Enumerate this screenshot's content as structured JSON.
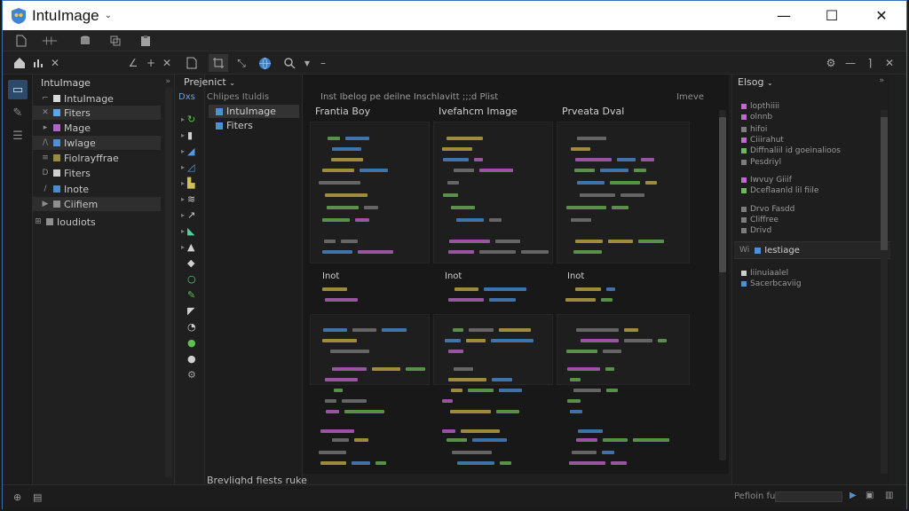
{
  "window": {
    "title": "IntuImage",
    "controls": {
      "minimize": "—",
      "maximize": "☐",
      "close": "✕"
    }
  },
  "explorer": {
    "title": "IntuImage",
    "items": [
      {
        "label": "IntuImage",
        "color": "#d8d8d8",
        "glyph": "⌐"
      },
      {
        "label": "Fiters",
        "color": "#5aa6e8",
        "glyph": "✕"
      },
      {
        "label": "Mage",
        "color": "#b265c8",
        "glyph": "▸"
      },
      {
        "label": "Iwlage",
        "color": "#4f8fd6",
        "glyph": "/\\"
      },
      {
        "label": "Fiolrayffrae",
        "color": "#9c8a3c",
        "glyph": "≡"
      },
      {
        "label": "Fiters",
        "color": "#cfcfcf",
        "glyph": "D"
      },
      {
        "label": "Inote",
        "color": "#4a8bd0",
        "glyph": "/"
      },
      {
        "label": "Ciifiem",
        "color": "#8f8f8f",
        "glyph": "▶"
      },
      {
        "label": "Ioudiots",
        "color": "#8f8f8f",
        "glyph": "⊞"
      }
    ]
  },
  "palette": {
    "icons": [
      "refresh-icon",
      "page-icon",
      "flip-icon",
      "triangle-icon",
      "frame-icon",
      "path-icon",
      "curve-icon",
      "arc-icon",
      "stamp-icon",
      "drop-icon",
      "ring-icon",
      "brush-icon",
      "clip-icon",
      "spin-icon",
      "fill-icon",
      "dot-icon",
      "gear-icon"
    ],
    "colors": [
      "#5ec24f",
      "#d0d0d0",
      "#4e9be8",
      "#4e9be8",
      "#d0c05a",
      "#d0d0d0",
      "#d0d0d0",
      "#4fcf9a",
      "#d0d0d0",
      "#d0d0d0",
      "#4fd07a",
      "#5ec24f",
      "#d0d0d0",
      "#d0d0d0",
      "#5ec24f",
      "#d0d0d0",
      "#a0a0a0"
    ]
  },
  "project": {
    "header": "Prejenict",
    "subheader_a": "Dxs",
    "subheader_b": "Chlipes  Ituldis",
    "items": [
      {
        "label": "IntuImage",
        "highlight": true
      },
      {
        "label": "Fiters",
        "highlight": false
      }
    ],
    "status": "Brevlighd fiests ruke"
  },
  "editor": {
    "headline": "Inst  Ibelog  pe deilne      Inschlavitt  ;;;d Plist",
    "right_tag": "Imeve",
    "columns": [
      "Frantia Boy",
      "Ivefahcm Image",
      "Prveata Dval"
    ],
    "section_labels": [
      "Inot",
      "Inot",
      "Inot"
    ],
    "accent_yellow": "#c9b24a",
    "accent_green": "#6fb85a",
    "accent_blue": "#4d8fd8",
    "accent_pink": "#c06acb"
  },
  "rightpanel": {
    "title": "Elsog",
    "items": [
      "lopthiiii",
      "olnnb",
      "hifoi",
      "Ciiirahut",
      "Diffnaliil id goeinalioos",
      "Pesdriyl",
      "Iwvuy Giiif",
      "Dceflaanld lil fiile",
      "Drvo Fasdd",
      "Cliffree",
      "Drivd"
    ],
    "section_label": "Iestiage",
    "section_items": [
      "Iiinuiaalel",
      "Sacerbcaviig"
    ]
  },
  "statusbar": {
    "field_label": "Pefioin fu"
  }
}
